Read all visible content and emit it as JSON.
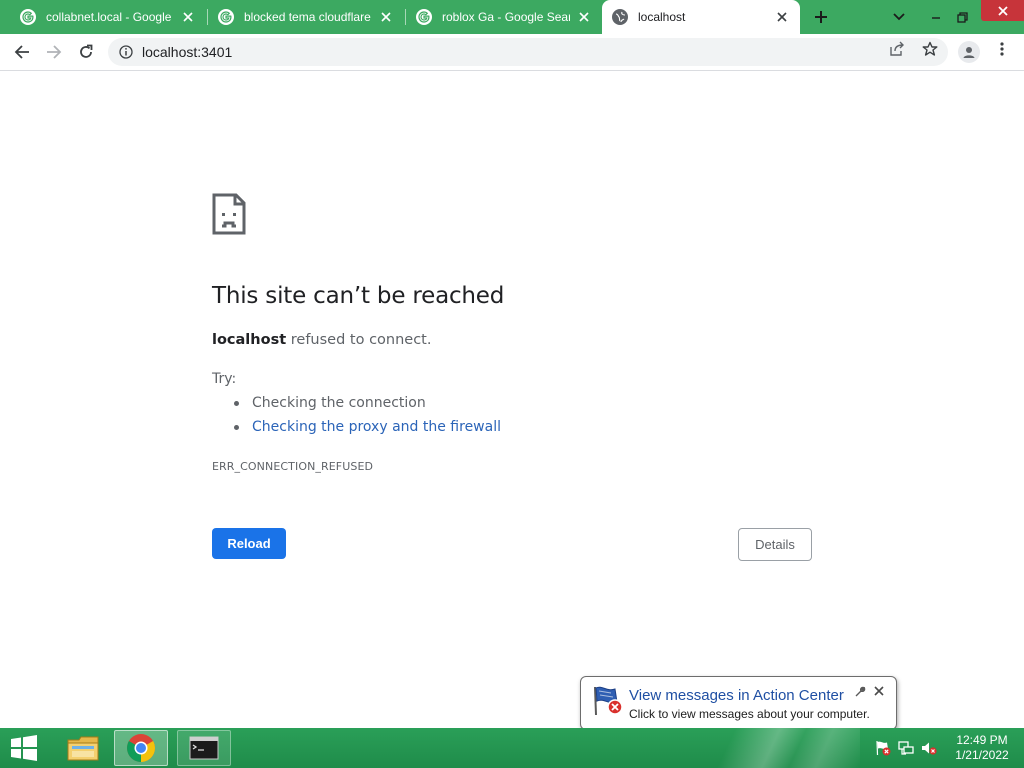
{
  "browser": {
    "tabs": [
      {
        "title": "collabnet.local - Google S",
        "favicon": "google-icon",
        "active": false
      },
      {
        "title": "blocked tema cloudflare",
        "favicon": "google-icon",
        "active": false
      },
      {
        "title": "roblox Ga - Google Searc",
        "favicon": "google-icon",
        "active": false
      },
      {
        "title": "localhost",
        "favicon": "globe-icon",
        "active": true
      }
    ],
    "new_tab_icon": "plus-icon",
    "tab_search_icon": "chevron-down-icon",
    "window_controls": [
      "minimize-icon",
      "restore-icon",
      "close-icon"
    ],
    "window_close_color": "#e81123",
    "tabstrip_color": "#3ca961",
    "address": "localhost:3401",
    "toolbar_icons": [
      "back-icon",
      "forward-icon",
      "reload-icon",
      "info-icon",
      "share-icon",
      "star-icon",
      "profile-icon",
      "menu-icon"
    ]
  },
  "error_page": {
    "icon": "sad-document-icon",
    "title": "This site can’t be reached",
    "host": "localhost",
    "message": " refused to connect.",
    "try_label": "Try:",
    "suggestions": [
      {
        "text": "Checking the connection",
        "is_link": false
      },
      {
        "text": "Checking the proxy and the firewall",
        "is_link": true
      }
    ],
    "error_code": "ERR_CONNECTION_REFUSED",
    "reload_label": "Reload",
    "details_label": "Details",
    "accent_color": "#1a73e8"
  },
  "notification": {
    "title": "View messages in Action Center",
    "text": "Click to view messages about your computer.",
    "icon": "action-center-flag-icon"
  },
  "taskbar": {
    "color": "#2a9f58",
    "items": [
      "windows-start-icon",
      "file-explorer-icon",
      "chrome-icon",
      "command-prompt-icon"
    ],
    "tray_icons": [
      "action-center-flag-icon",
      "network-icon",
      "volume-muted-icon"
    ],
    "time": "12:49 PM",
    "date": "1/21/2022"
  }
}
